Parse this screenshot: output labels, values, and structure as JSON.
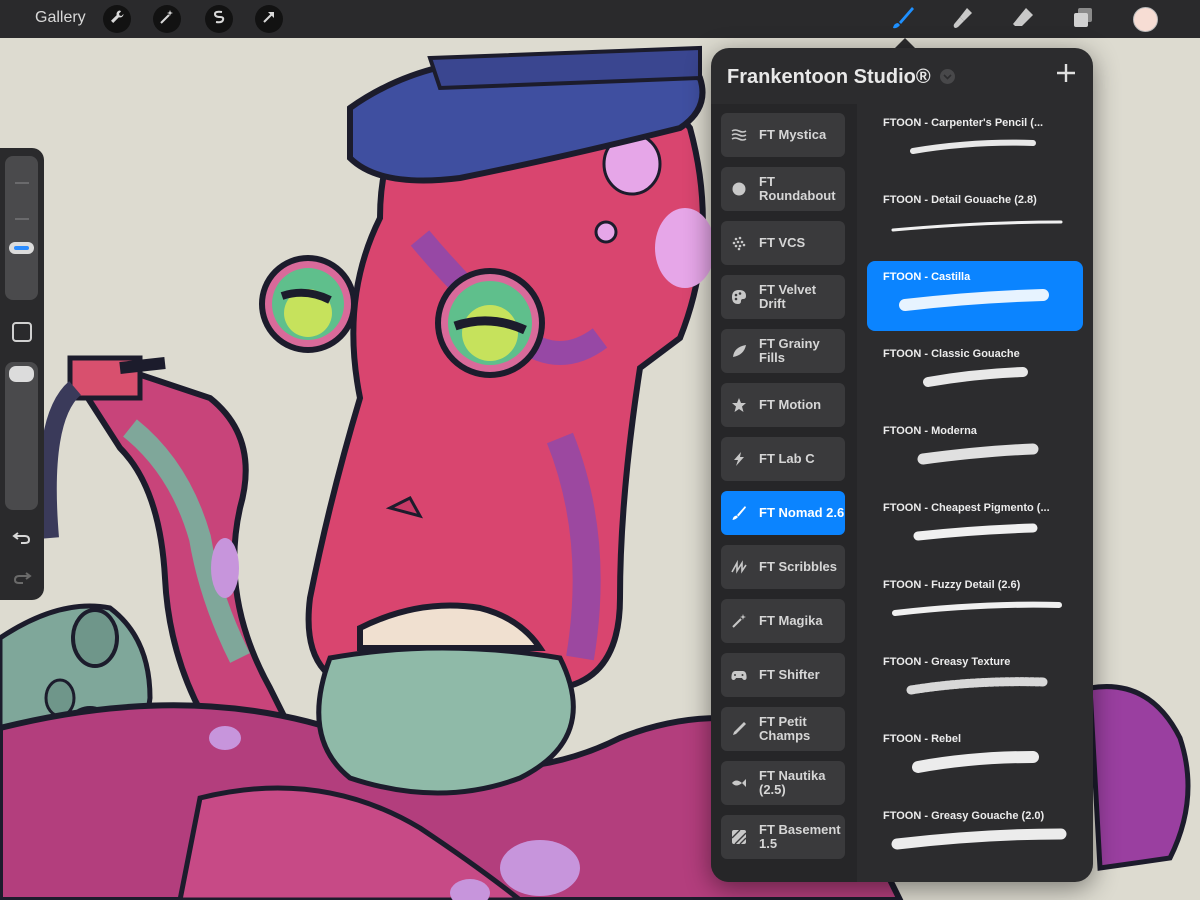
{
  "topbar": {
    "gallery_label": "Gallery",
    "left_tools": [
      "wrench-icon",
      "magic-wand-icon",
      "selection-icon",
      "transform-arrow-icon"
    ],
    "right_tools": [
      "brush-icon",
      "smudge-icon",
      "eraser-icon",
      "layers-icon"
    ],
    "current_color": "#f7ddd4",
    "accent_color": "#0b84ff"
  },
  "library": {
    "title": "Frankentoon Studio®",
    "sets": [
      {
        "label": "FT Mystica",
        "icon": "waves-icon",
        "active": false
      },
      {
        "label": "FT Roundabout",
        "icon": "circle-icon",
        "active": false
      },
      {
        "label": "FT VCS",
        "icon": "dots-icon",
        "active": false
      },
      {
        "label": "FT Velvet Drift",
        "icon": "palette-icon",
        "active": false
      },
      {
        "label": "FT Grainy Fills",
        "icon": "leaf-icon",
        "active": false
      },
      {
        "label": "FT Motion",
        "icon": "star-icon",
        "active": false
      },
      {
        "label": "FT Lab C",
        "icon": "bolt-icon",
        "active": false
      },
      {
        "label": "FT Nomad 2.6",
        "icon": "brush-icon",
        "active": true
      },
      {
        "label": "FT Scribbles",
        "icon": "scribble-icon",
        "active": false
      },
      {
        "label": "FT Magika",
        "icon": "wand-icon",
        "active": false
      },
      {
        "label": "FT Shifter",
        "icon": "gamepad-icon",
        "active": false
      },
      {
        "label": "FT Petit Champs",
        "icon": "pen-icon",
        "active": false
      },
      {
        "label": "FT Nautika (2.5)",
        "icon": "fish-icon",
        "active": false
      },
      {
        "label": "FT Basement 1.5",
        "icon": "hatch-icon",
        "active": false
      }
    ],
    "brushes": [
      {
        "name": "FTOON - Carpenter's Pencil (...",
        "active": false
      },
      {
        "name": "FTOON - Detail Gouache (2.8)",
        "active": false
      },
      {
        "name": "FTOON - Castilla",
        "active": true
      },
      {
        "name": "FTOON - Classic Gouache",
        "active": false
      },
      {
        "name": "FTOON - Moderna",
        "active": false
      },
      {
        "name": "FTOON - Cheapest Pigmento (...",
        "active": false
      },
      {
        "name": "FTOON - Fuzzy Detail (2.6)",
        "active": false
      },
      {
        "name": "FTOON - Greasy Texture",
        "active": false
      },
      {
        "name": "FTOON - Rebel",
        "active": false
      },
      {
        "name": "FTOON - Greasy Gouache (2.0)",
        "active": false
      }
    ]
  }
}
